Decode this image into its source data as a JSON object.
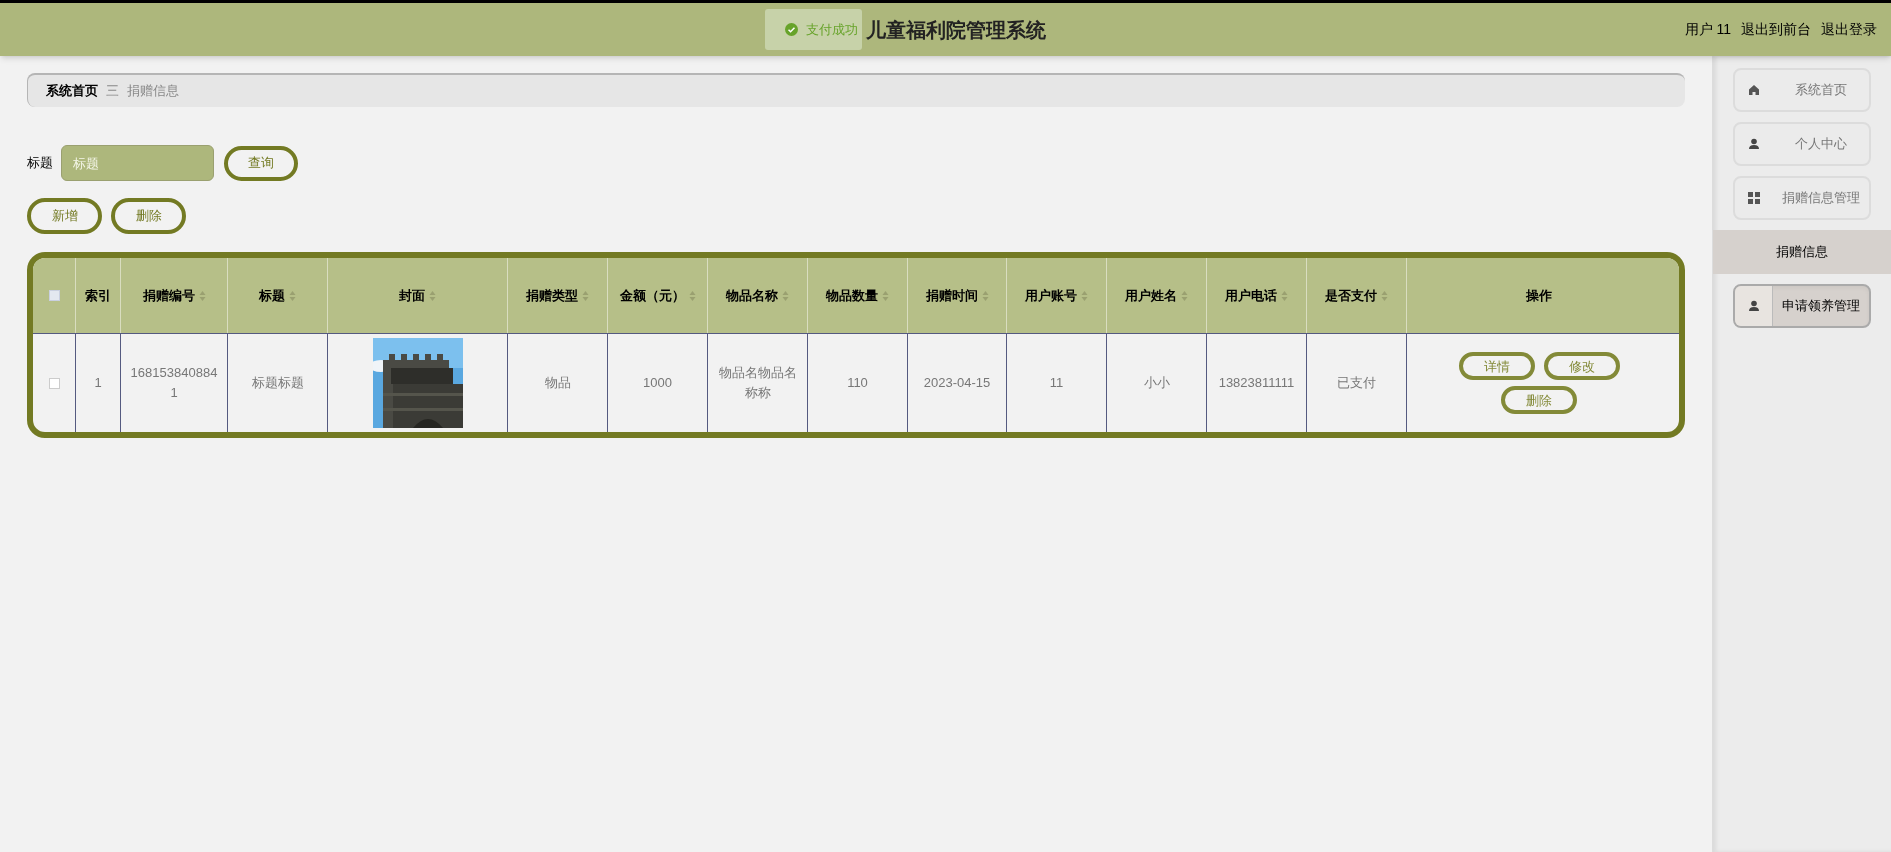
{
  "header": {
    "title": "儿童福利院管理系统",
    "toast": "支付成功",
    "user": "用户 11",
    "links": [
      "退出到前台",
      "退出登录"
    ]
  },
  "breadcrumb": {
    "items": [
      "系统首页",
      "捐赠信息"
    ],
    "separator": "三"
  },
  "search": {
    "label": "标题",
    "placeholder": "标题",
    "button": "查询"
  },
  "actions": [
    "新增",
    "删除"
  ],
  "table": {
    "all_checked": false,
    "columns": [
      {
        "label": "索引",
        "sortable": false
      },
      {
        "label": "捐赠编号",
        "sortable": true
      },
      {
        "label": "标题",
        "sortable": true
      },
      {
        "label": "封面",
        "sortable": true
      },
      {
        "label": "捐赠类型",
        "sortable": true
      },
      {
        "label": "金额（元）",
        "sortable": true
      },
      {
        "label": "物品名称",
        "sortable": true
      },
      {
        "label": "物品数量",
        "sortable": true
      },
      {
        "label": "捐赠时间",
        "sortable": true
      },
      {
        "label": "用户账号",
        "sortable": true
      },
      {
        "label": "用户姓名",
        "sortable": true
      },
      {
        "label": "用户电话",
        "sortable": true
      },
      {
        "label": "是否支付",
        "sortable": true
      },
      {
        "label": "操作",
        "sortable": false
      }
    ],
    "rows": [
      {
        "checked": false,
        "cells": [
          "1",
          "1681538408841",
          "标题标题",
          {
            "kind": "picture"
          },
          "物品",
          "1000",
          "物品名物品名称称",
          "110",
          "2023-04-15",
          "11",
          "小小",
          "13823811111",
          "已支付"
        ],
        "buttons": [
          "详情",
          "修改",
          "删除"
        ]
      }
    ]
  },
  "sidebar": {
    "items": [
      {
        "kind": "menu",
        "label": "系统首页",
        "hovered": false
      },
      {
        "kind": "menu",
        "label": "个人中心",
        "hovered": false
      },
      {
        "kind": "menu",
        "label": "捐赠信息管理",
        "hovered": false
      },
      {
        "kind": "submenu",
        "label": "捐赠信息"
      },
      {
        "kind": "menu",
        "label": "申请领养管理",
        "hovered": true
      }
    ]
  }
}
